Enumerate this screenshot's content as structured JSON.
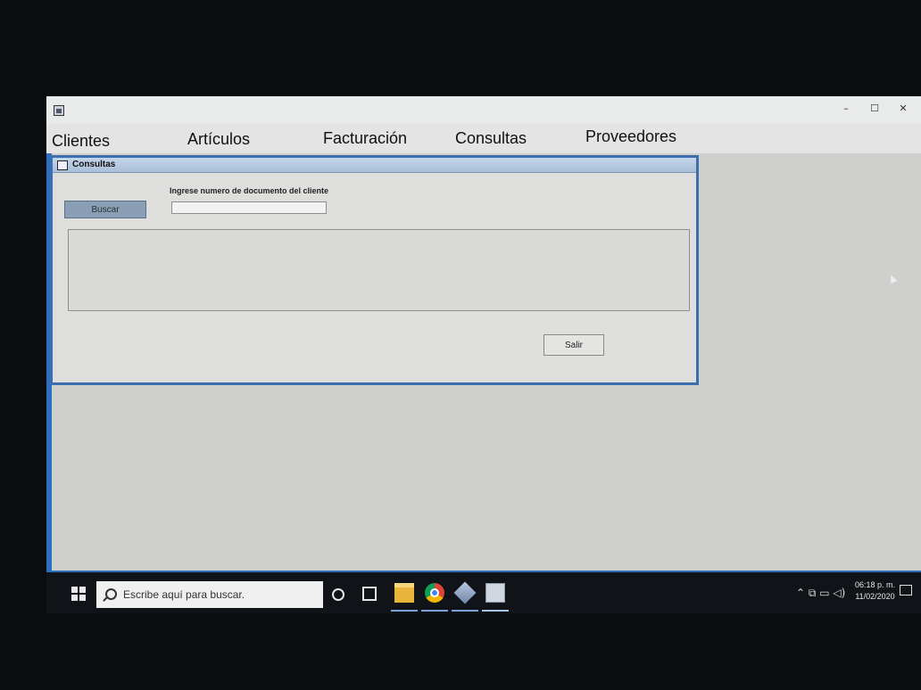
{
  "window": {
    "controls": [
      "–",
      "☐",
      "✕"
    ]
  },
  "menu": {
    "items": [
      "Clientes",
      "Artículos",
      "Facturación",
      "Consultas",
      "Proveedores"
    ]
  },
  "consultas_frame": {
    "title": "Consultas",
    "doc_label": "Ingrese numero de documento del cliente",
    "doc_value": "",
    "search_button": "Buscar",
    "exit_button": "Salir"
  },
  "taskbar": {
    "search_placeholder": "Escribe aquí para buscar.",
    "time": "06:18 p. m.",
    "date": "11/02/2020",
    "icons": [
      "windows-start-icon",
      "cortana-icon",
      "task-view-icon",
      "file-explorer-icon",
      "chrome-icon",
      "cube-app-icon",
      "java-app-icon"
    ]
  },
  "colors": {
    "frame_border": "#3d6fb0",
    "button_blue": "#8a9fb5",
    "taskbar": "#101317"
  }
}
